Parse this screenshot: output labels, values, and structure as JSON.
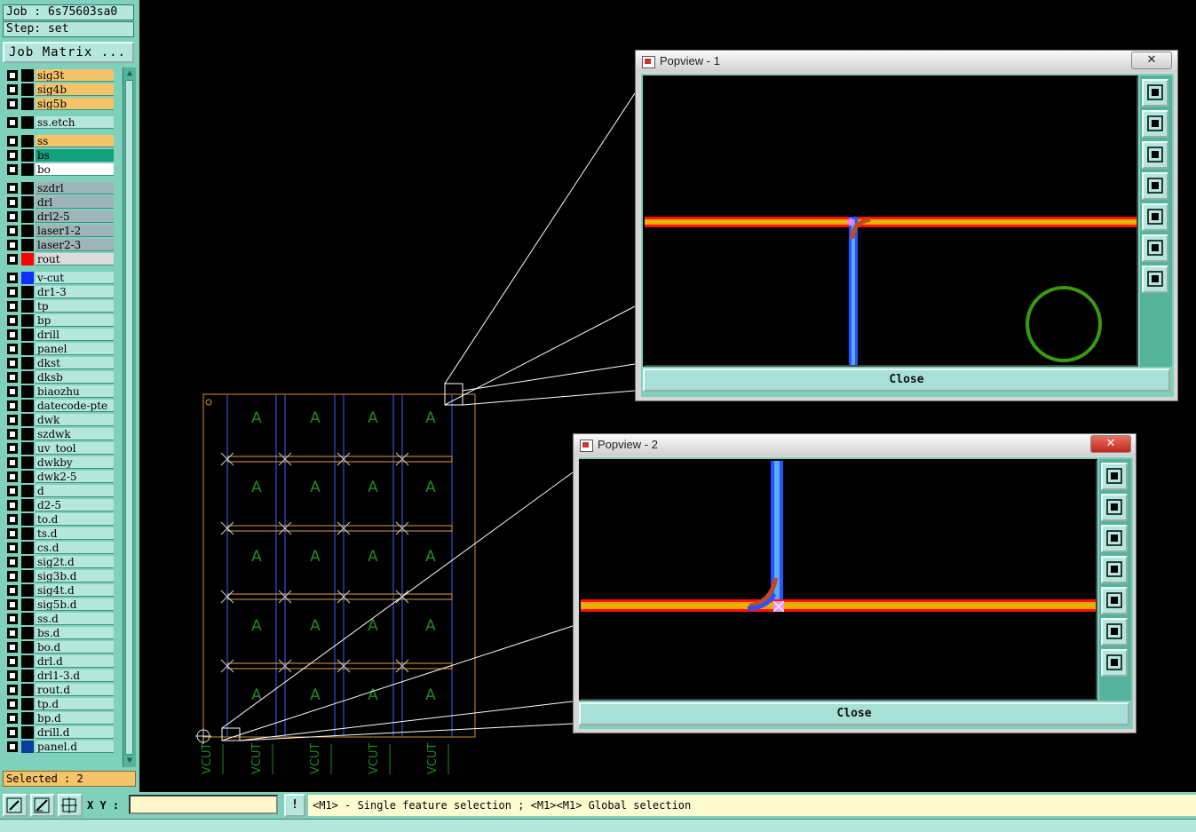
{
  "header": {
    "job": "Job : 6s75603sa0",
    "step": "Step: set",
    "job_matrix": "Job Matrix ..."
  },
  "layers": [
    {
      "name": "sig3t",
      "bg": "#f4c46a",
      "color": ""
    },
    {
      "name": "sig4b",
      "bg": "#f4c46a",
      "color": ""
    },
    {
      "name": "sig5b",
      "bg": "#f4c46a",
      "color": ""
    },
    {
      "name": "ss.etch",
      "bg": "#b5e7de",
      "color": ""
    },
    {
      "name": "ss",
      "bg": "#f4c46a",
      "color": ""
    },
    {
      "name": "bs",
      "bg": "#14a07c",
      "color": ""
    },
    {
      "name": "bo",
      "bg": "#ffffff",
      "color": ""
    },
    {
      "name": "szdrl",
      "bg": "#9fb4b8",
      "color": ""
    },
    {
      "name": "drl",
      "bg": "#9fb4b8",
      "color": ""
    },
    {
      "name": "drl2-5",
      "bg": "#9fb4b8",
      "color": ""
    },
    {
      "name": "laser1-2",
      "bg": "#9fb4b8",
      "color": ""
    },
    {
      "name": "laser2-3",
      "bg": "#9fb4b8",
      "color": ""
    },
    {
      "name": "rout",
      "bg": "#dcdcdc",
      "color": "#ff0000"
    },
    {
      "name": "v-cut",
      "bg": "#b5e7de",
      "color": "#1030ff"
    },
    {
      "name": "dr1-3",
      "bg": "#b5e7de",
      "color": ""
    },
    {
      "name": "tp",
      "bg": "#b5e7de",
      "color": ""
    },
    {
      "name": "bp",
      "bg": "#b5e7de",
      "color": ""
    },
    {
      "name": "drill",
      "bg": "#b5e7de",
      "color": ""
    },
    {
      "name": "panel",
      "bg": "#b5e7de",
      "color": ""
    },
    {
      "name": "dkst",
      "bg": "#b5e7de",
      "color": ""
    },
    {
      "name": "dksb",
      "bg": "#b5e7de",
      "color": ""
    },
    {
      "name": "biaozhu",
      "bg": "#b5e7de",
      "color": ""
    },
    {
      "name": "datecode-pte",
      "bg": "#b5e7de",
      "color": ""
    },
    {
      "name": "dwk",
      "bg": "#b5e7de",
      "color": ""
    },
    {
      "name": "szdwk",
      "bg": "#b5e7de",
      "color": ""
    },
    {
      "name": "uv_tool",
      "bg": "#b5e7de",
      "color": ""
    },
    {
      "name": "dwkby",
      "bg": "#b5e7de",
      "color": ""
    },
    {
      "name": "dwk2-5",
      "bg": "#b5e7de",
      "color": ""
    },
    {
      "name": "d",
      "bg": "#b5e7de",
      "color": ""
    },
    {
      "name": "d2-5",
      "bg": "#b5e7de",
      "color": ""
    },
    {
      "name": "to.d",
      "bg": "#b5e7de",
      "color": ""
    },
    {
      "name": "ts.d",
      "bg": "#b5e7de",
      "color": ""
    },
    {
      "name": "cs.d",
      "bg": "#b5e7de",
      "color": ""
    },
    {
      "name": "sig2t.d",
      "bg": "#b5e7de",
      "color": ""
    },
    {
      "name": "sig3b.d",
      "bg": "#b5e7de",
      "color": ""
    },
    {
      "name": "sig4t.d",
      "bg": "#b5e7de",
      "color": ""
    },
    {
      "name": "sig5b.d",
      "bg": "#b5e7de",
      "color": ""
    },
    {
      "name": "ss.d",
      "bg": "#b5e7de",
      "color": ""
    },
    {
      "name": "bs.d",
      "bg": "#b5e7de",
      "color": ""
    },
    {
      "name": "bo.d",
      "bg": "#b5e7de",
      "color": ""
    },
    {
      "name": "drl.d",
      "bg": "#b5e7de",
      "color": ""
    },
    {
      "name": "drl1-3.d",
      "bg": "#b5e7de",
      "color": ""
    },
    {
      "name": "rout.d",
      "bg": "#b5e7de",
      "color": ""
    },
    {
      "name": "tp.d",
      "bg": "#b5e7de",
      "color": ""
    },
    {
      "name": "bp.d",
      "bg": "#b5e7de",
      "color": ""
    },
    {
      "name": "drill.d",
      "bg": "#b5e7de",
      "color": ""
    },
    {
      "name": "panel.d",
      "bg": "#b5e7de",
      "color": "#0a3d9a"
    }
  ],
  "selected": "Selected : 2",
  "canvas": {
    "board_letter": "A",
    "vcut_label": "VCUT"
  },
  "popview1": {
    "title": "Popview - 1",
    "close_x": "✕",
    "close_label": "Close"
  },
  "popview2": {
    "title": "Popview - 2",
    "close_x": "✕",
    "close_label": "Close"
  },
  "bottom": {
    "xy_label": "X Y :",
    "xy_value": "",
    "info_label": "!",
    "status": "<M1> - Single feature selection ; <M1><M1> Global selection"
  },
  "colors": {
    "panel_bg": "#7fd1bb",
    "board_outline": "#e0a040",
    "vcut_line": "#4060ff",
    "text_green": "#1f8a1f"
  }
}
